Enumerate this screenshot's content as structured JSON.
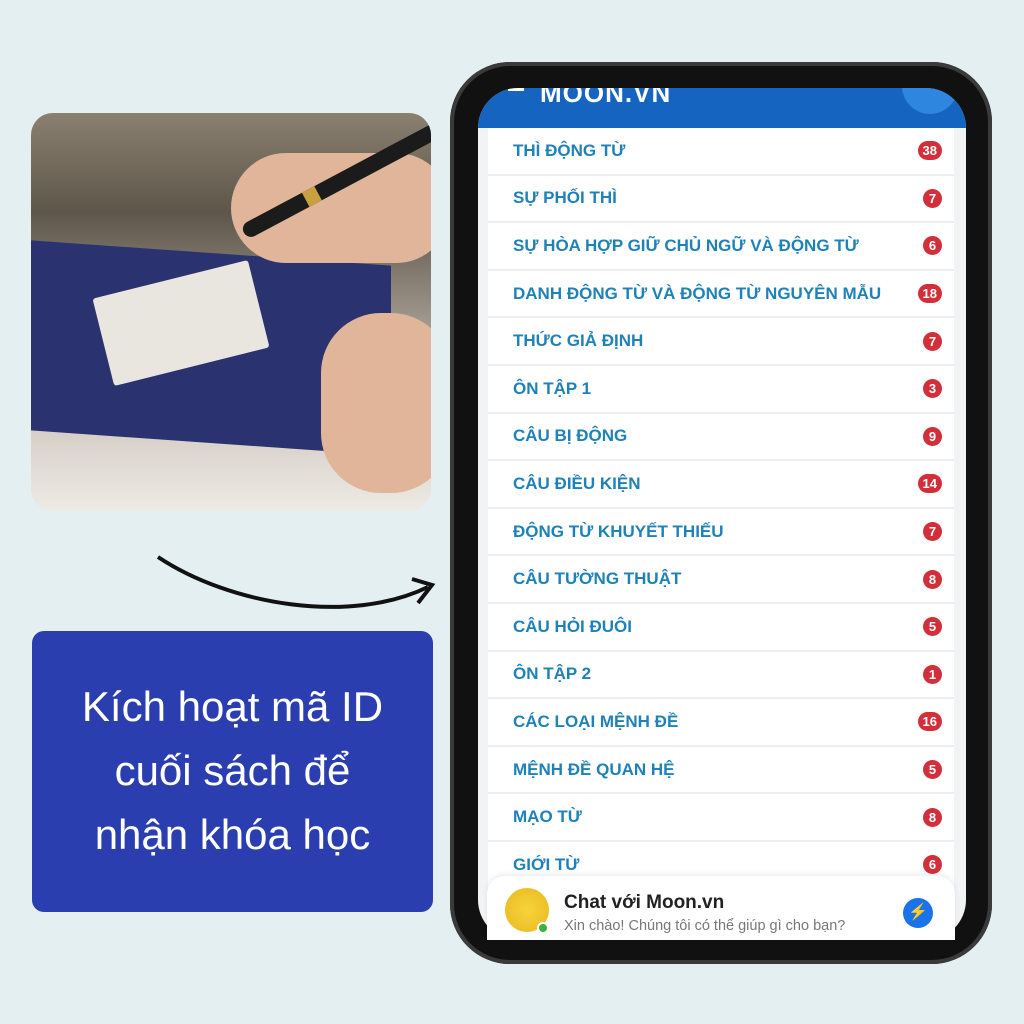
{
  "cta": {
    "lines": [
      "Kích hoạt mã ID",
      "cuối sách để",
      "nhận khóa học"
    ],
    "color": "#2b3eb0"
  },
  "app": {
    "logo": "MOON.VN",
    "header_color": "#1565c0"
  },
  "topics": [
    {
      "label": "THÌ ĐỘNG TỪ",
      "count": "38"
    },
    {
      "label": "SỰ PHỐI THÌ",
      "count": "7"
    },
    {
      "label": "SỰ HÒA HỢP GIỮ CHỦ NGỮ VÀ ĐỘNG TỪ",
      "count": "6"
    },
    {
      "label": "DANH ĐỘNG TỪ VÀ ĐỘNG TỪ NGUYÊN MẪU",
      "count": "18"
    },
    {
      "label": "THỨC GIẢ ĐỊNH",
      "count": "7"
    },
    {
      "label": "ÔN TẬP 1",
      "count": "3"
    },
    {
      "label": "CÂU BỊ ĐỘNG",
      "count": "9"
    },
    {
      "label": "CÂU ĐIỀU KIỆN",
      "count": "14"
    },
    {
      "label": "ĐỘNG TỪ KHUYẾT THIẾU",
      "count": "7"
    },
    {
      "label": "CÂU TƯỜNG THUẬT",
      "count": "8"
    },
    {
      "label": "CÂU HỎI ĐUÔI",
      "count": "5"
    },
    {
      "label": "ÔN TẬP 2",
      "count": "1"
    },
    {
      "label": "CÁC LOẠI MỆNH ĐỀ",
      "count": "16"
    },
    {
      "label": "MỆNH ĐỀ QUAN HỆ",
      "count": "5"
    },
    {
      "label": "MẠO TỪ",
      "count": "8"
    },
    {
      "label": "GIỚI TỪ",
      "count": "6"
    }
  ],
  "chat": {
    "title": "Chat với Moon.vn",
    "subtitle": "Xin chào! Chúng tôi có thể giúp gì cho bạn?",
    "icon": "messenger-icon"
  }
}
